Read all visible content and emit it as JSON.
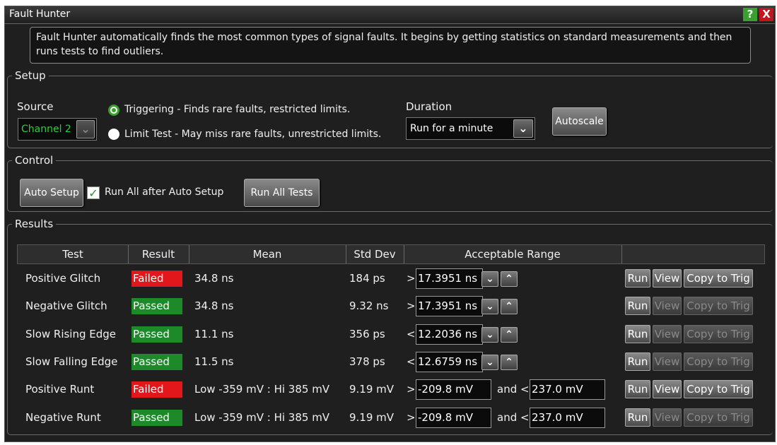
{
  "window": {
    "title": "Fault Hunter",
    "help_label": "?",
    "close_label": "X"
  },
  "description": "Fault Hunter automatically finds the most common types of signal faults. It begins by getting statistics on standard measurements and then runs tests to find outliers.",
  "setup": {
    "legend": "Setup",
    "source_label": "Source",
    "source_value": "Channel 2",
    "mode_options": [
      {
        "label": "Triggering - Finds rare faults, restricted limits.",
        "selected": true
      },
      {
        "label": "Limit Test - May miss rare faults, unrestricted limits.",
        "selected": false
      }
    ],
    "duration_label": "Duration",
    "duration_value": "Run for a minute",
    "autoscale_label": "Autoscale"
  },
  "control": {
    "legend": "Control",
    "auto_setup_label": "Auto Setup",
    "run_all_after_label": "Run All after Auto Setup",
    "run_all_after_checked": true,
    "run_all_tests_label": "Run All Tests"
  },
  "results": {
    "legend": "Results",
    "columns": [
      "Test",
      "Result",
      "Mean",
      "Std Dev",
      "Acceptable Range",
      ""
    ],
    "run_label": "Run",
    "view_label": "View",
    "copy_label": "Copy to Trig",
    "and_label": "and <",
    "rows": [
      {
        "test": "Positive Glitch",
        "result": "Failed",
        "mean": "34.8 ns",
        "std": "184 ps",
        "cmp": ">",
        "range": "17.3951 ns",
        "view_enabled": true
      },
      {
        "test": "Negative Glitch",
        "result": "Passed",
        "mean": "34.8 ns",
        "std": "9.32 ns",
        "cmp": ">",
        "range": "17.3951 ns",
        "view_enabled": false
      },
      {
        "test": "Slow Rising Edge",
        "result": "Passed",
        "mean": "11.1 ns",
        "std": "356 ps",
        "cmp": "<",
        "range": "12.2036 ns",
        "view_enabled": false
      },
      {
        "test": "Slow Falling Edge",
        "result": "Passed",
        "mean": "11.5 ns",
        "std": "378 ps",
        "cmp": "<",
        "range": "12.6759 ns",
        "view_enabled": false
      },
      {
        "test": "Positive Runt",
        "result": "Failed",
        "mean": "Low -359 mV : Hi 385 mV",
        "std": "9.19 mV",
        "cmp": ">",
        "range": "-209.8 mV",
        "range_hi": "237.0 mV",
        "view_enabled": true
      },
      {
        "test": "Negative Runt",
        "result": "Passed",
        "mean": "Low -359 mV : Hi 385 mV",
        "std": "9.19 mV",
        "cmp": ">",
        "range": "-209.8 mV",
        "range_hi": "237.0 mV",
        "view_enabled": false
      }
    ]
  },
  "colors": {
    "failed": "#e2171b",
    "passed": "#1d8a2a",
    "radio_selected": "#3aa02e",
    "source_text": "#2ecc40"
  }
}
